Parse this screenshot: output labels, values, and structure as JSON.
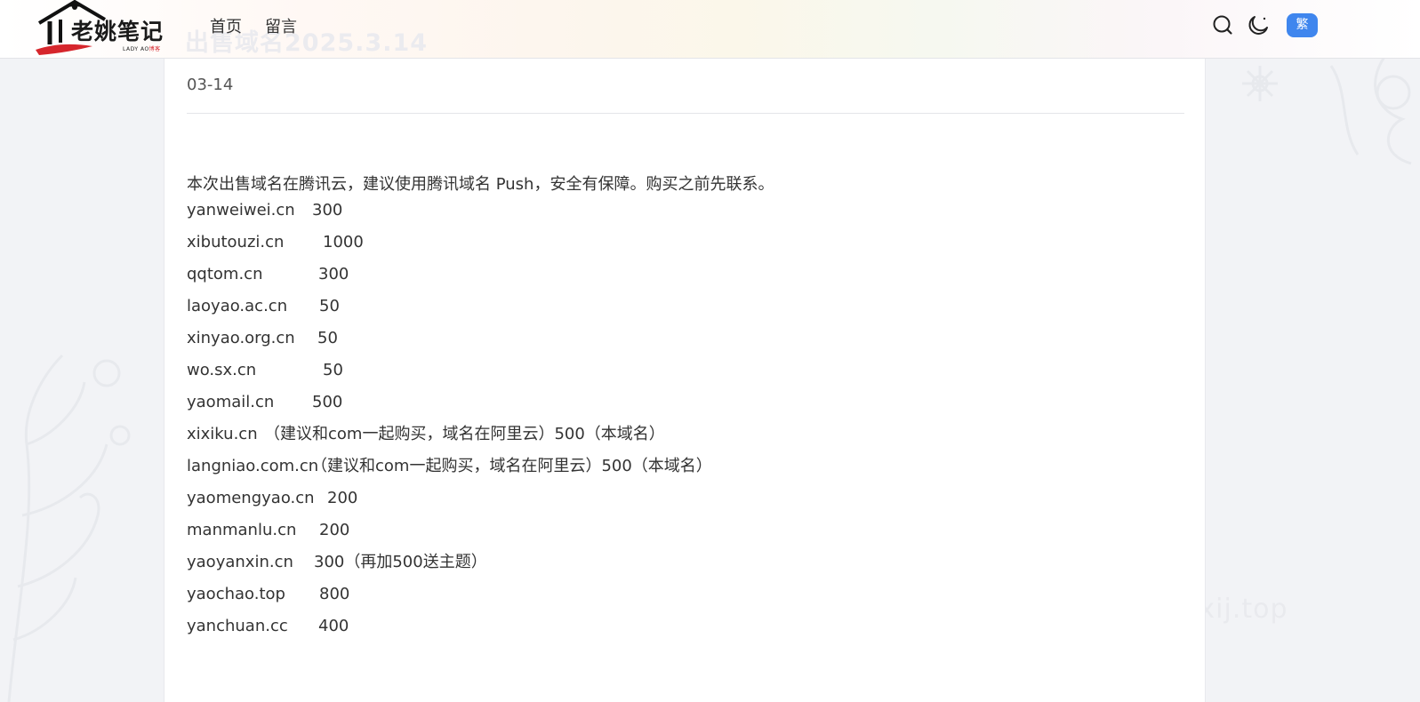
{
  "header": {
    "logo_text": "老姚笔记",
    "logo_sub": "LADY AO",
    "logo_sub_accent": "博客",
    "ghost_title": "出售域名2025.3.14",
    "nav": [
      {
        "label": "首页"
      },
      {
        "label": "留言"
      }
    ],
    "icons": {
      "search": "search-icon",
      "theme": "moon-icon"
    },
    "lang_button": "繁",
    "accent_color": "#3f86ee"
  },
  "post": {
    "date": "03-14",
    "intro": "本次出售域名在腾讯云，建议使用腾讯域名 Push，安全有保障。购买之前先联系。",
    "domains": [
      {
        "name": "yanweiwei.cn",
        "price": "300"
      },
      {
        "name": "xibutouzi.cn",
        "price": "1000"
      },
      {
        "name": "qqtom.cn",
        "price": "300"
      },
      {
        "name": "laoyao.ac.cn",
        "price": "50"
      },
      {
        "name": "xinyao.org.cn",
        "price": "50"
      },
      {
        "name": "wo.sx.cn",
        "price": "50"
      },
      {
        "name": "yaomail.cn",
        "price": "500"
      },
      {
        "name": "xixiku.cn",
        "price": "（建议和com一起购买，域名在阿里云）500（本域名）"
      },
      {
        "name": "langniao.com.cn",
        "price": "（建议和com一起购买，域名在阿里云）500（本域名）"
      },
      {
        "name": "yaomengyao.cn",
        "price": "200"
      },
      {
        "name": "manmanlu.cn",
        "price": "200"
      },
      {
        "name": "yaoyanxin.cn",
        "price": "300（再加500送主题）"
      },
      {
        "name": "yaochao.top",
        "price": "800"
      },
      {
        "name": "yanchuan.cc",
        "price": "400"
      }
    ]
  },
  "watermark": "oxij.top"
}
